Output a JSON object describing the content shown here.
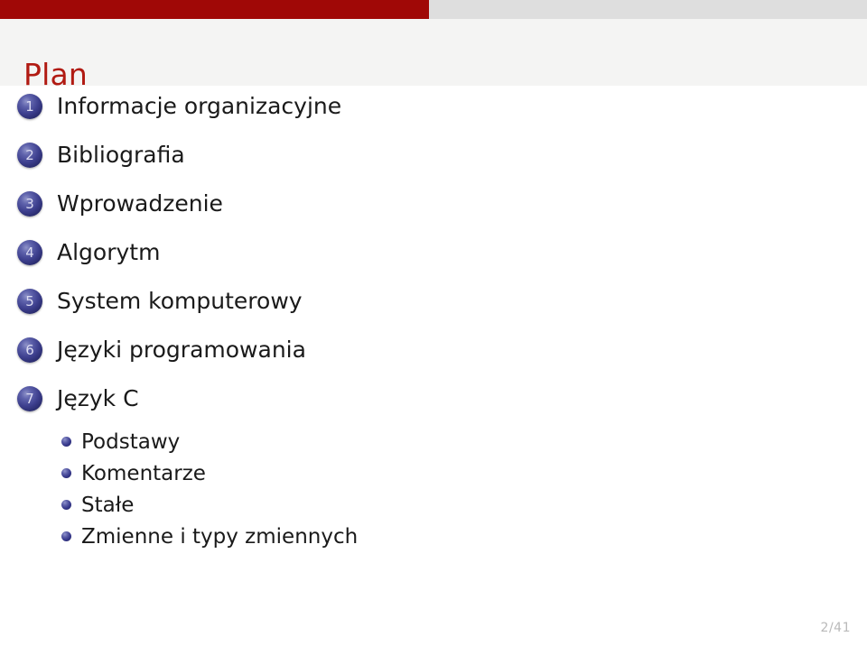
{
  "theme": {
    "accent_color": "#a00806",
    "title_color": "#b11a12",
    "headbar_color": "#dedede",
    "title_band_color": "#f4f4f3",
    "bullet_color": "#3d3f8e",
    "text_color": "#1a1a1a",
    "footer_color": "#b9b9b9"
  },
  "header": {
    "title": "Plan"
  },
  "toc": {
    "items": [
      {
        "number": "1",
        "label": "Informacje organizacyjne"
      },
      {
        "number": "2",
        "label": "Bibliografia"
      },
      {
        "number": "3",
        "label": "Wprowadzenie"
      },
      {
        "number": "4",
        "label": "Algorytm"
      },
      {
        "number": "5",
        "label": "System komputerowy"
      },
      {
        "number": "6",
        "label": "Języki programowania"
      },
      {
        "number": "7",
        "label": "Język C"
      }
    ],
    "subitems": [
      {
        "label": "Podstawy"
      },
      {
        "label": "Komentarze"
      },
      {
        "label": "Stałe"
      },
      {
        "label": "Zmienne i typy zmiennych"
      }
    ]
  },
  "footer": {
    "page_indicator": "2/41"
  }
}
